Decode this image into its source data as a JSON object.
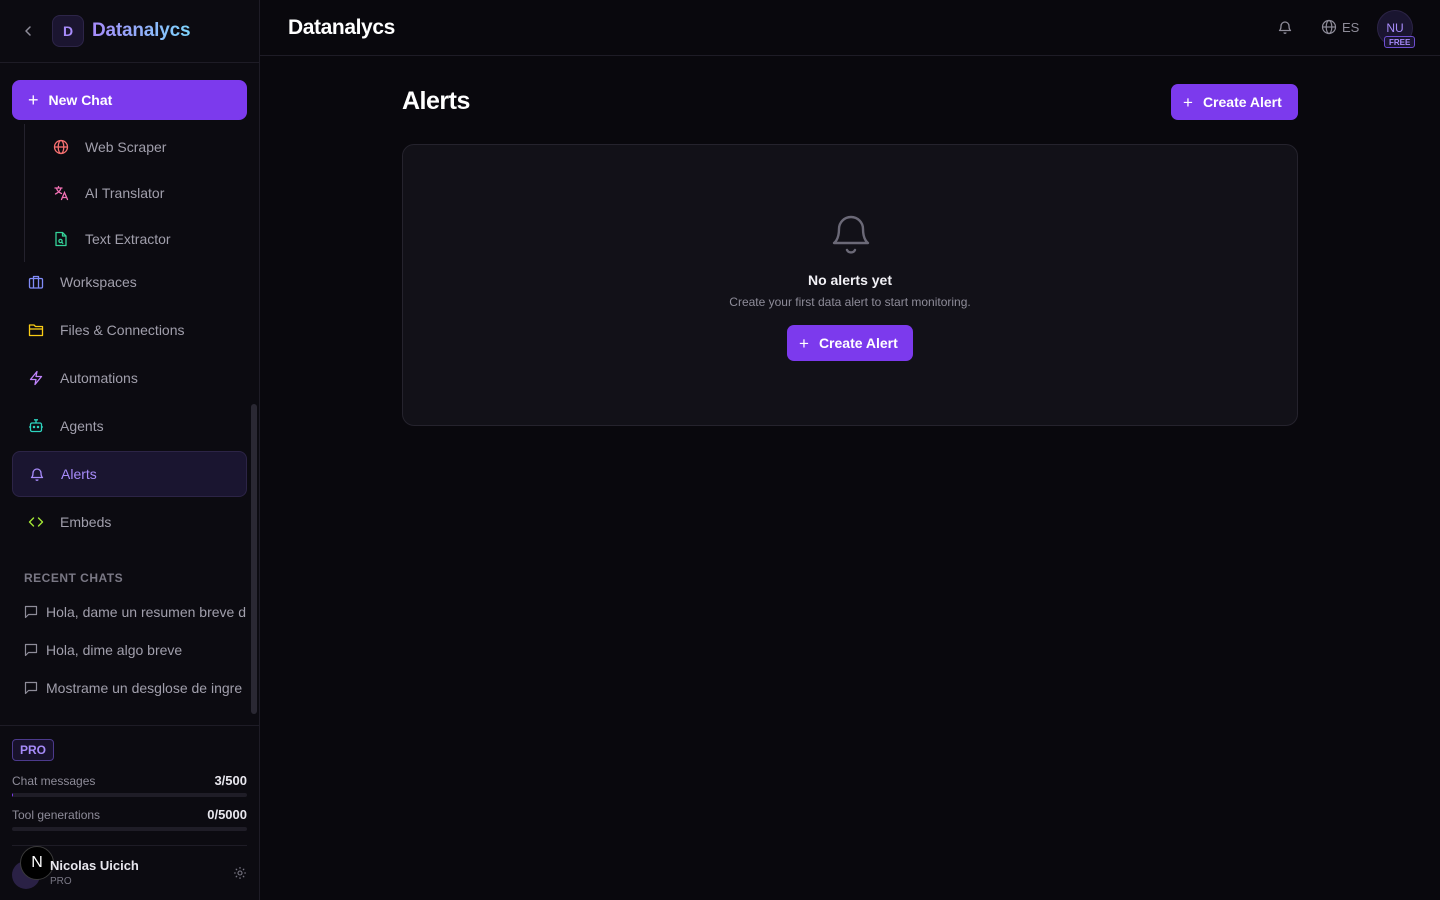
{
  "brand": {
    "logo_letter": "D",
    "name": "Datanalycs"
  },
  "sidebar": {
    "new_chat_label": "New Chat",
    "tools": [
      {
        "label": "Web Scraper",
        "icon": "globe-icon",
        "color": "#f87171"
      },
      {
        "label": "AI Translator",
        "icon": "translate-icon",
        "color": "#f472b6"
      },
      {
        "label": "Text Extractor",
        "icon": "file-text-icon",
        "color": "#34d399"
      }
    ],
    "nav": [
      {
        "label": "Workspaces",
        "icon": "briefcase-icon",
        "color": "#818cf8"
      },
      {
        "label": "Files & Connections",
        "icon": "folder-icon",
        "color": "#facc15"
      },
      {
        "label": "Automations",
        "icon": "zap-icon",
        "color": "#c084fc"
      },
      {
        "label": "Agents",
        "icon": "bot-icon",
        "color": "#2dd4bf"
      },
      {
        "label": "Alerts",
        "icon": "bell-icon",
        "color": "#a78bfa",
        "active": true
      },
      {
        "label": "Embeds",
        "icon": "code-icon",
        "color": "#a3e635"
      }
    ],
    "recent_title": "RECENT CHATS",
    "recent_chats": [
      "Hola, dame un resumen breve d",
      "Hola, dime algo breve",
      "Mostrame un desglose de ingre"
    ]
  },
  "plan": {
    "badge": "PRO",
    "chat_messages": {
      "label": "Chat messages",
      "value": "3/500",
      "fraction": 0.006
    },
    "tool_generations": {
      "label": "Tool generations",
      "value": "0/5000",
      "fraction": 0
    }
  },
  "user": {
    "avatar_badge": "N",
    "name": "Nicolas Uicich",
    "plan": "PRO"
  },
  "topbar": {
    "title": "Datanalycs",
    "lang": "ES",
    "avatar": "NU",
    "tier": "FREE"
  },
  "main": {
    "title": "Alerts",
    "create_label": "Create Alert",
    "empty": {
      "title": "No alerts yet",
      "subtitle": "Create your first data alert to start monitoring.",
      "cta": "Create Alert"
    }
  },
  "colors": {
    "accent": "#7c3aed",
    "accent_light": "#a78bfa",
    "background": "#09080d"
  }
}
